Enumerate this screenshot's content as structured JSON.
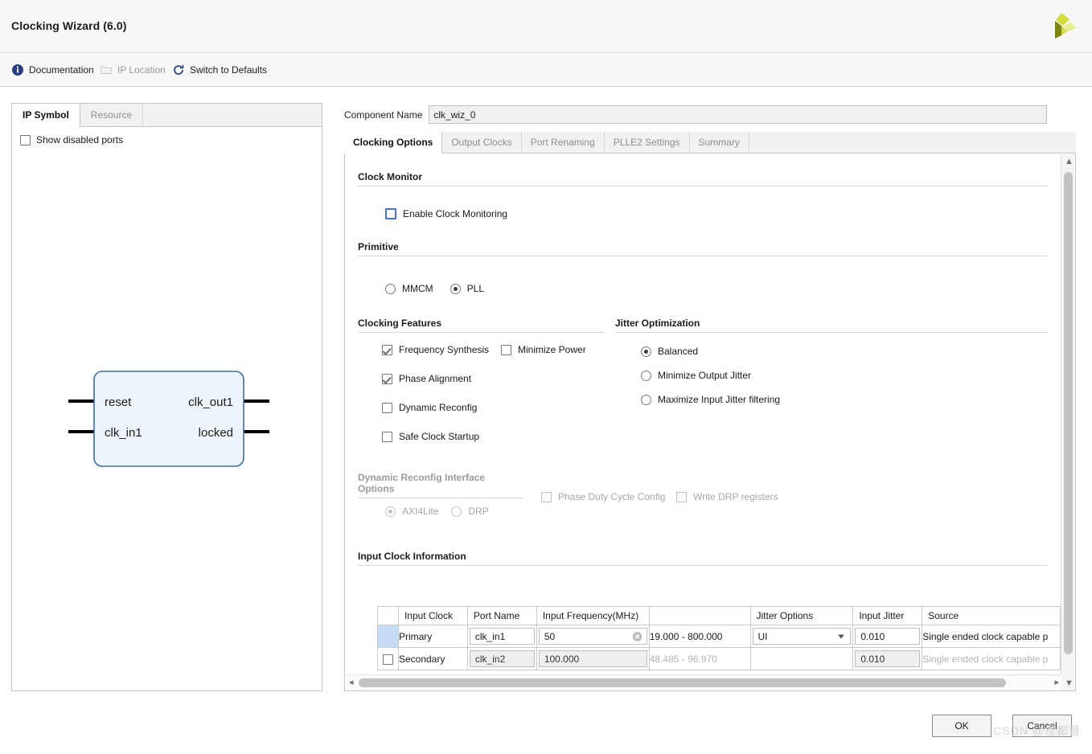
{
  "header": {
    "title": "Clocking Wizard (6.0)",
    "logo_name": "xilinx-logo",
    "logo_colors": [
      "#c8d22d",
      "#e3ec8a",
      "#7b8414"
    ]
  },
  "toolbar": {
    "items": [
      {
        "label": "Documentation",
        "icon": "info-icon",
        "disabled": false
      },
      {
        "label": "IP Location",
        "icon": "folder-icon",
        "disabled": true
      },
      {
        "label": "Switch to Defaults",
        "icon": "refresh-icon",
        "disabled": false
      }
    ]
  },
  "left_panel": {
    "tabs": [
      {
        "label": "IP Symbol",
        "active": true
      },
      {
        "label": "Resource",
        "active": false
      }
    ],
    "show_disabled_ports": {
      "label": "Show disabled ports",
      "checked": false
    },
    "symbol": {
      "inputs": [
        "reset",
        "clk_in1"
      ],
      "outputs": [
        "clk_out1",
        "locked"
      ],
      "fill": "#eef4fb",
      "stroke": "#3b6ea5"
    }
  },
  "component": {
    "label": "Component Name",
    "value": "clk_wiz_0"
  },
  "main_tabs": [
    {
      "label": "Clocking Options",
      "active": true
    },
    {
      "label": "Output Clocks",
      "active": false
    },
    {
      "label": "Port Renaming",
      "active": false
    },
    {
      "label": "PLLE2 Settings",
      "active": false
    },
    {
      "label": "Summary",
      "active": false
    }
  ],
  "sections": {
    "clock_monitor": {
      "title": "Clock Monitor",
      "enable_clock_monitoring": {
        "label": "Enable Clock Monitoring",
        "checked": false
      }
    },
    "primitive": {
      "title": "Primitive",
      "options": [
        {
          "label": "MMCM",
          "selected": false
        },
        {
          "label": "PLL",
          "selected": true
        }
      ]
    },
    "clocking_features": {
      "title": "Clocking Features",
      "items": [
        {
          "label": "Frequency Synthesis",
          "checked": true
        },
        {
          "label": "Minimize Power",
          "checked": false
        },
        {
          "label": "Phase Alignment",
          "checked": true
        },
        {
          "label": "Dynamic Reconfig",
          "checked": false
        },
        {
          "label": "Safe Clock Startup",
          "checked": false
        }
      ]
    },
    "jitter_optimization": {
      "title": "Jitter Optimization",
      "options": [
        {
          "label": "Balanced",
          "selected": true
        },
        {
          "label": "Minimize Output Jitter",
          "selected": false
        },
        {
          "label": "Maximize Input Jitter filtering",
          "selected": false
        }
      ]
    },
    "dynamic_reconfig": {
      "title": "Dynamic Reconfig Interface Options",
      "disabled": true,
      "radios": [
        {
          "label": "AXI4Lite",
          "selected": true
        },
        {
          "label": "DRP",
          "selected": false
        }
      ],
      "checkboxes": [
        {
          "label": "Phase Duty Cycle Config",
          "checked": false
        },
        {
          "label": "Write DRP registers",
          "checked": false
        }
      ]
    },
    "input_clock_information": {
      "title": "Input Clock Information",
      "columns": [
        "",
        "Input Clock",
        "Port Name",
        "Input Frequency(MHz)",
        "",
        "Jitter Options",
        "Input Jitter",
        "Source"
      ],
      "rows": [
        {
          "selected": true,
          "enabled": true,
          "input_clock": "Primary",
          "port_name": "clk_in1",
          "input_frequency": "50",
          "frequency_range": "19.000 - 800.000",
          "jitter_options": "UI",
          "input_jitter": "0.010",
          "source": "Single ended clock capable p"
        },
        {
          "selected": false,
          "enabled": false,
          "input_clock": "Secondary",
          "port_name": "clk_in2",
          "input_frequency": "100.000",
          "frequency_range": "48.485 - 96.970",
          "jitter_options": "",
          "input_jitter": "0.010",
          "source": "Single ended clock capable p"
        }
      ]
    }
  },
  "footer": {
    "ok_label": "OK",
    "cancel_label": "Cancel",
    "watermark": "CSDN @怪都督"
  }
}
